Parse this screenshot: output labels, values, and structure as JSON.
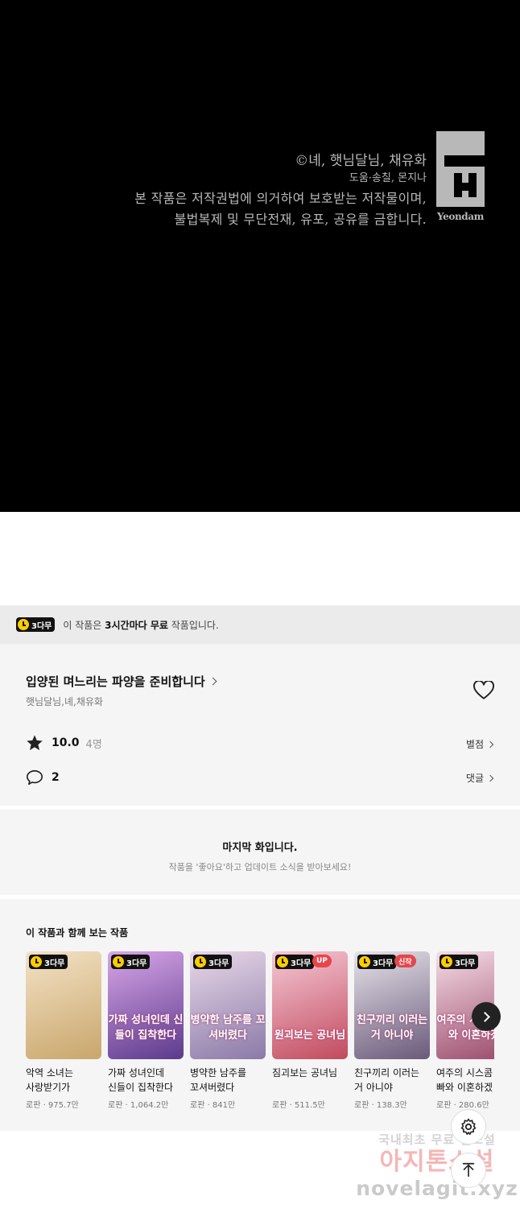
{
  "copyright": {
    "line1": "©녜, 햇님달님, 채유화",
    "line2": "도움·송칠, 몬지나",
    "line3": "본 작품은 저작권법에 의거하여 보호받는 저작물이며,",
    "line4": "불법복제 및 무단전재, 유포, 공유를 금합니다.",
    "logo_text": "Yeondam"
  },
  "notice": {
    "badge": "3다무",
    "text_prefix": "이 작품은 ",
    "text_bold": "3시간마다 무료",
    "text_suffix": " 작품입니다."
  },
  "work": {
    "title": "입양된 며느리는 파양을 준비합니다",
    "authors": "햇님달님,녜,채유화",
    "rating": "10.0",
    "rating_count": "4명",
    "rating_link": "별점",
    "comments": "2",
    "comments_link": "댓글"
  },
  "last_episode": {
    "heading": "마지막 화입니다.",
    "sub": "작품을 '좋아요'하고 업데이트 소식을 받아보세요!"
  },
  "recommendations": {
    "title": "이 작품과 함께 보는 작품",
    "items": [
      {
        "title": "악역 소녀는 사랑받기가 부끄러워…",
        "meta": "로판 · 975.7만",
        "badge": "3다무",
        "tag": "",
        "art": "",
        "colors": [
          "#f3e2c6",
          "#c9a66b"
        ]
      },
      {
        "title": "가짜 성녀인데 신들이 집착한다",
        "meta": "로판 · 1,064.2만",
        "badge": "3다무",
        "tag": "",
        "art": "가짜 성녀인데 신들이 집착한다",
        "colors": [
          "#d9a6e8",
          "#5b3a8c"
        ]
      },
      {
        "title": "병약한 남주를 꼬셔버렸다",
        "meta": "로판 · 841만",
        "badge": "3다무",
        "tag": "",
        "art": "병약한 남주를 꼬셔버렸다",
        "colors": [
          "#e9d8e8",
          "#8a7aa8"
        ]
      },
      {
        "title": "짐괴보는 공녀님",
        "meta": "로판 · 511.5만",
        "badge": "3다무",
        "tag": "UP",
        "art": "원괴보는 공녀님",
        "colors": [
          "#f5c9d6",
          "#c24a5e"
        ]
      },
      {
        "title": "친구끼리 이러는 거 아니야",
        "meta": "로판 · 138.3만",
        "badge": "3다무",
        "tag": "신작",
        "art": "친구끼리 이러는 거 아니야",
        "colors": [
          "#e7e3ea",
          "#6a5a7a"
        ]
      },
      {
        "title": "여주의 시스콤 빠와 이혼하겠",
        "meta": "로판 · 280.6만",
        "badge": "3다무",
        "tag": "",
        "art": "여주의 시스콤 빠와 이혼하겠",
        "colors": [
          "#f6dde6",
          "#9a4a6a"
        ]
      }
    ]
  },
  "watermark": {
    "line1": "국내최초 무료 웹소설",
    "line2": "아지톤소설",
    "line3": "novelagit.xyz"
  },
  "icons": {
    "heart": "heart-icon",
    "star": "star-icon",
    "comment": "comment-icon",
    "clock": "clock-icon",
    "gear": "gear-icon",
    "arrow_up": "arrow-up-icon",
    "next": "chevron-right-icon"
  },
  "colors": {
    "badge_yellow": "#ffcc00",
    "tag_up": "#e8454b",
    "tag_new": "#e8454b"
  }
}
